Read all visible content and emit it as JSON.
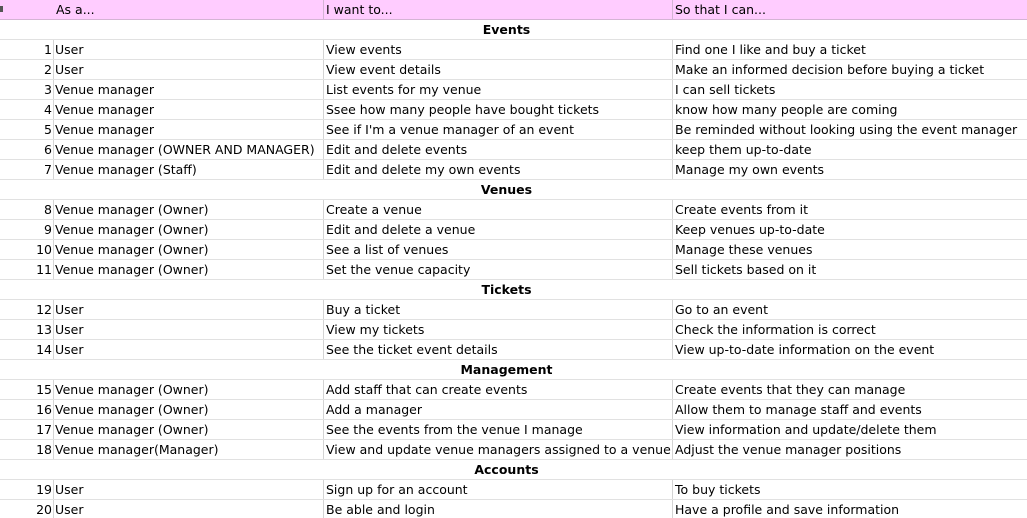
{
  "header": {
    "num": "",
    "as": "As a...",
    "want": "I want to...",
    "so": "So that I can..."
  },
  "rows": [
    {
      "section": "Events"
    },
    {
      "num": "1",
      "as": "User",
      "want": "View events",
      "so": "Find one I like and buy a ticket"
    },
    {
      "num": "2",
      "as": "User",
      "want": "View event details",
      "so": "Make an informed decision before buying a ticket"
    },
    {
      "num": "3",
      "as": "Venue manager",
      "want": "List events for my venue",
      "so": "I can sell tickets"
    },
    {
      "num": "4",
      "as": "Venue manager",
      "want": "Ssee how many people have bought tickets",
      "so": "know how many people are coming"
    },
    {
      "num": "5",
      "as": "Venue manager",
      "want": "See if I'm a venue manager of an event",
      "so": "Be reminded without looking using the event manager"
    },
    {
      "num": "6",
      "as": "Venue manager (OWNER AND MANAGER)",
      "want": "Edit and delete events",
      "so": "keep them up-to-date"
    },
    {
      "num": "7",
      "as": "Venue manager (Staff)",
      "want": "Edit and delete my own events",
      "so": "Manage my own events"
    },
    {
      "section": "Venues"
    },
    {
      "num": "8",
      "as": "Venue manager (Owner)",
      "want": "Create a venue",
      "so": "Create events from it"
    },
    {
      "num": "9",
      "as": "Venue manager (Owner)",
      "want": "Edit and delete a venue",
      "so": "Keep venues up-to-date"
    },
    {
      "num": "10",
      "as": "Venue manager (Owner)",
      "want": "See a list of venues",
      "so": "Manage these venues"
    },
    {
      "num": "11",
      "as": "Venue manager (Owner)",
      "want": "Set the venue capacity",
      "so": "Sell tickets based on it"
    },
    {
      "section": "Tickets"
    },
    {
      "num": "12",
      "as": "User",
      "want": "Buy a ticket",
      "so": "Go to an event"
    },
    {
      "num": "13",
      "as": "User",
      "want": "View my tickets",
      "so": "Check the information is correct"
    },
    {
      "num": "14",
      "as": "User",
      "want": "See the ticket event details",
      "so": "View up-to-date information on the event"
    },
    {
      "section": "Management"
    },
    {
      "num": "15",
      "as": "Venue manager (Owner)",
      "want": "Add staff that can create events",
      "so": "Create events that they can manage"
    },
    {
      "num": "16",
      "as": "Venue manager (Owner)",
      "want": "Add a manager",
      "so": "Allow them to manage staff and events"
    },
    {
      "num": "17",
      "as": "Venue manager (Owner)",
      "want": "See the events from the venue I manage",
      "so": "View information and update/delete them"
    },
    {
      "num": "18",
      "as": "Venue manager(Manager)",
      "want": "View and update venue managers assigned to a venue",
      "so": "Adjust the venue manager positions"
    },
    {
      "section": "Accounts"
    },
    {
      "num": "19",
      "as": "User",
      "want": "Sign up for an account",
      "so": "To buy tickets"
    },
    {
      "num": "20",
      "as": "User",
      "want": "Be able and login",
      "so": "Have a profile and save information"
    }
  ]
}
